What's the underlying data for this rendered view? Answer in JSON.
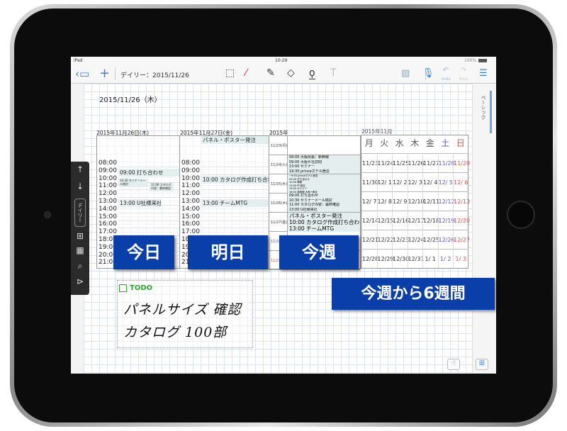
{
  "status_bar": {
    "device": "iPad",
    "time": "10:29",
    "battery": "100%"
  },
  "toolbar": {
    "title": "デイリー：2015/11/26",
    "undo": "Undo",
    "redo": "Redo"
  },
  "side_panel": {
    "tab": "ベーシック"
  },
  "left_tools": {
    "daily": "デイリー"
  },
  "page": {
    "date_title": "2015/11/26（木）",
    "day1": {
      "header": "2015年11月26日(木)",
      "times": [
        "08:00",
        "09:00",
        "10:00",
        "11:00",
        "12:00",
        "13:00",
        "14:00",
        "15:00",
        "16:00",
        "17:00",
        "18:00",
        "19:00",
        "20:00",
        "21:00"
      ],
      "events": [
        "09:00 打ち合わせ",
        "10:30 セミナーメール検討",
        "11:00 カタログ内容：最終確認",
        "13:00 U社様来社"
      ]
    },
    "day2": {
      "header": "2015年11月27日(金)",
      "allday": "パネル・ポスター発注",
      "times": [
        "08:00",
        "09:00",
        "10:00",
        "11:00",
        "12:00",
        "13:00",
        "14:00",
        "15:00",
        "16:00",
        "17:00",
        "18:00",
        "19:00",
        "20:00",
        "21:00"
      ],
      "events": [
        "10:00 カタログ作成打ち合わせ",
        "13:00 チームMTG"
      ]
    },
    "week": {
      "header": "2015年",
      "rows": [
        {
          "date": "11/23(月)",
          "events": []
        },
        {
          "date": "11/24(火)",
          "events": [
            "09:00 大阪出張：新幹線",
            "09:00 大阪Ｋ社訪問",
            "13:00 セミナー",
            "19:30 princeホテル宿泊"
          ]
        },
        {
          "date": "11/25(水)",
          "events": [
            "~9:00 princeホテル宿泊",
            "09:00 打ち合わせ",
            "10:00 移動",
            "13:00 PC設定",
            "15:00 セミナー",
            "18:00 新幹線 大阪→東京"
          ]
        },
        {
          "date": "11/26(木)",
          "events": [
            "09:00 打ち合わせ",
            "10:30 セミナーメール検討",
            "11:00 カタログ内容：最終確認",
            "13:00 U社様来社"
          ]
        },
        {
          "date": "11/27(金)",
          "events": [
            "パネル・ポスター発注",
            "10:00 カタログ作成打ち合わせ",
            "13:00 チームMTG"
          ]
        },
        {
          "date": "11/28(土)",
          "events": []
        },
        {
          "date": "11/29(日)",
          "events": []
        }
      ]
    },
    "month": {
      "header": "2015年11月",
      "weekdays": [
        "月",
        "火",
        "水",
        "木",
        "金",
        "土",
        "日"
      ],
      "weeks": [
        [
          "11/23",
          "11/24",
          "11/25",
          "11/26",
          "11/27",
          "11/28",
          "11/29"
        ],
        [
          "11/30",
          "12/ 1",
          "12/ 2",
          "12/ 3",
          "12/ 4",
          "12/ 5",
          "12/ 6"
        ],
        [
          "12/ 7",
          "12/ 8",
          "12/ 9",
          "12/10",
          "12/11",
          "12/12",
          "12/13"
        ],
        [
          "12/14",
          "12/15",
          "12/16",
          "12/17",
          "12/18",
          "12/19",
          "12/20"
        ],
        [
          "12/21",
          "12/22",
          "12/23",
          "12/24",
          "12/25",
          "12/26",
          "12/27"
        ],
        [
          "12/28",
          "12/29",
          "12/30",
          "12/31",
          "1/ 1",
          "1/ 2",
          "1/ 3"
        ]
      ]
    },
    "todo": {
      "label": "TODO",
      "lines": [
        "パネルサイズ 確認",
        "カタログ 100部"
      ]
    }
  },
  "labels": {
    "today": "今日",
    "tomorrow": "明日",
    "this_week": "今週",
    "six_weeks": "今週から6週間"
  },
  "colors": {
    "accent": "#3a82e0",
    "label_bg": "#0a3ea8",
    "saturday": "#5555cc",
    "sunday": "#e05050",
    "todo": "#2aa52a"
  }
}
